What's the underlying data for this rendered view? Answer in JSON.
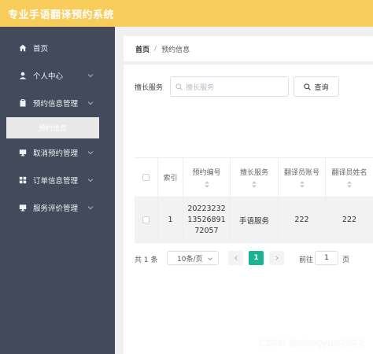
{
  "app": {
    "title": "专业手语翻译预约系统"
  },
  "sidebar": {
    "items": [
      {
        "label": "首页",
        "icon": "home-icon",
        "has_children": false
      },
      {
        "label": "个人中心",
        "icon": "user-icon",
        "has_children": true
      },
      {
        "label": "预约信息管理",
        "icon": "clipboard-icon",
        "has_children": true
      },
      {
        "label": "取消预约管理",
        "icon": "monitor-icon",
        "has_children": true
      },
      {
        "label": "订单信息管理",
        "icon": "grid-icon",
        "has_children": true
      },
      {
        "label": "服务评价管理",
        "icon": "monitor-icon",
        "has_children": true
      }
    ],
    "active_submenu": {
      "label": "预约信息"
    }
  },
  "breadcrumb": {
    "home": "首页",
    "separator": "/",
    "current": "预约信息"
  },
  "search": {
    "label": "擅长服务",
    "placeholder": "擅长服务",
    "button_label": "查询"
  },
  "table": {
    "columns": [
      "索引",
      "预约编号",
      "擅长服务",
      "翻译员账号",
      "翻译员姓名"
    ],
    "rows": [
      {
        "index": "1",
        "booking_no_lines": [
          "20223232",
          "13526891",
          "72057"
        ],
        "service": "手语服务",
        "translator_account": "222",
        "translator_name": "222"
      }
    ]
  },
  "pagination": {
    "total": "共 1 条",
    "page_size": "10条/页",
    "current_page": "1",
    "goto_label": "前往",
    "goto_value": "1",
    "goto_suffix": "页"
  },
  "watermark": "CSDN @dongyun2022",
  "colors": {
    "topbar": "#f7cc5b",
    "sidebar": "#434a5b",
    "accent": "#1ab394"
  }
}
